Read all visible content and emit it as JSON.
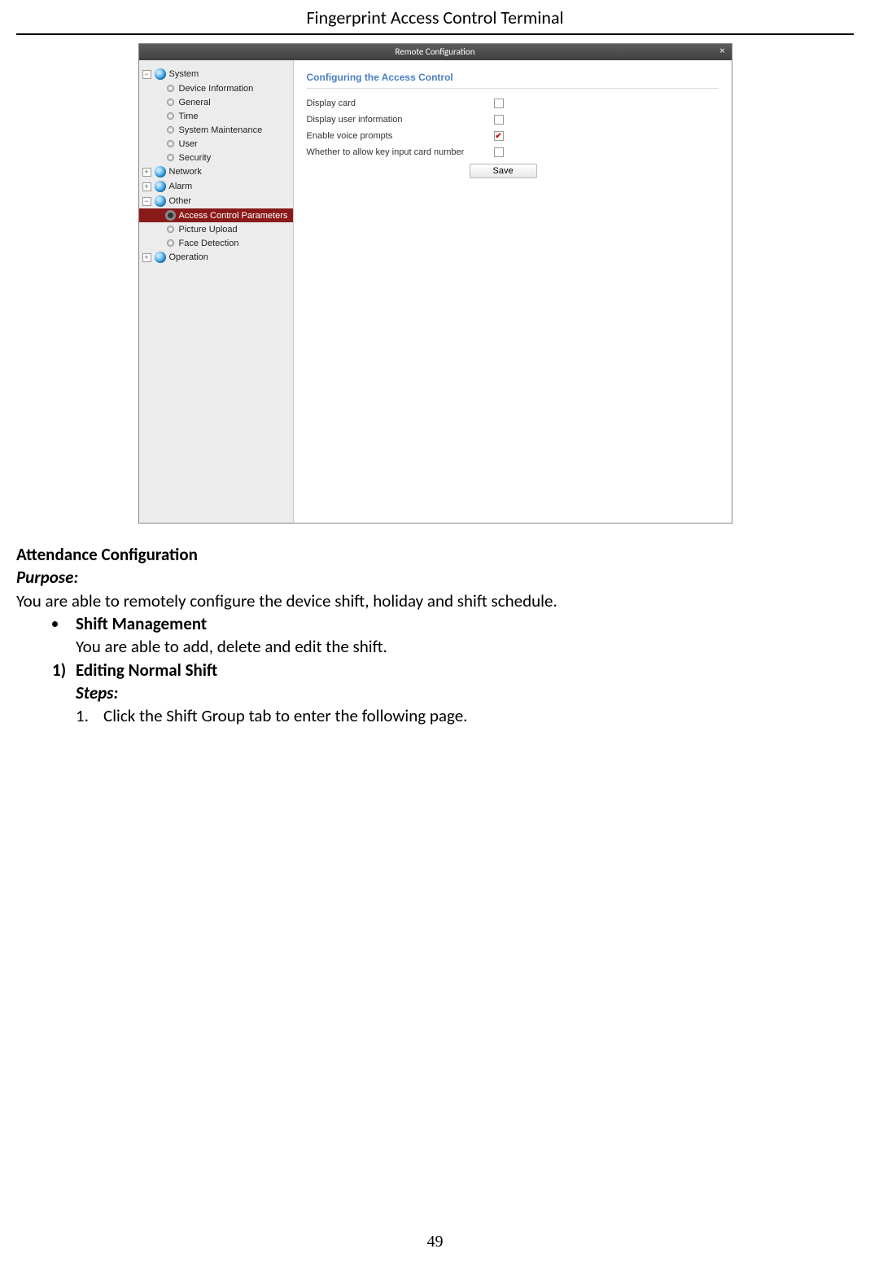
{
  "doc_header": "Fingerprint Access Control Terminal",
  "page_number": "49",
  "window": {
    "title": "Remote Configuration",
    "close_glyph": "×"
  },
  "tree": {
    "system": {
      "label": "System",
      "expander": "−"
    },
    "system_children": [
      {
        "label": "Device Information"
      },
      {
        "label": "General"
      },
      {
        "label": "Time"
      },
      {
        "label": "System Maintenance"
      },
      {
        "label": "User"
      },
      {
        "label": "Security"
      }
    ],
    "network": {
      "label": "Network",
      "expander": "+"
    },
    "alarm": {
      "label": "Alarm",
      "expander": "+"
    },
    "other": {
      "label": "Other",
      "expander": "−"
    },
    "other_children": [
      {
        "label": "Access Control Parameters",
        "selected": true
      },
      {
        "label": "Picture Upload"
      },
      {
        "label": "Face Detection"
      }
    ],
    "operation": {
      "label": "Operation",
      "expander": "+"
    }
  },
  "panel": {
    "heading": "Configuring the Access Control",
    "rows": [
      {
        "label": "Display card",
        "checked": false
      },
      {
        "label": "Display user information",
        "checked": false
      },
      {
        "label": "Enable voice prompts",
        "checked": true
      },
      {
        "label": "Whether to allow key input card number",
        "checked": false
      }
    ],
    "save_label": "Save"
  },
  "text": {
    "h1": "Attendance Configuration",
    "purpose_label": "Purpose:",
    "purpose_body": "You are able to remotely configure the device shift, holiday and shift schedule.",
    "bullet_title": "Shift Management",
    "bullet_body": "You are able to add, delete and edit the shift.",
    "num_marker": "1)",
    "num_title": "Editing Normal Shift",
    "steps_label": "Steps:",
    "step1_num": "1.",
    "step1_body": "Click the Shift Group tab to enter the following page."
  }
}
